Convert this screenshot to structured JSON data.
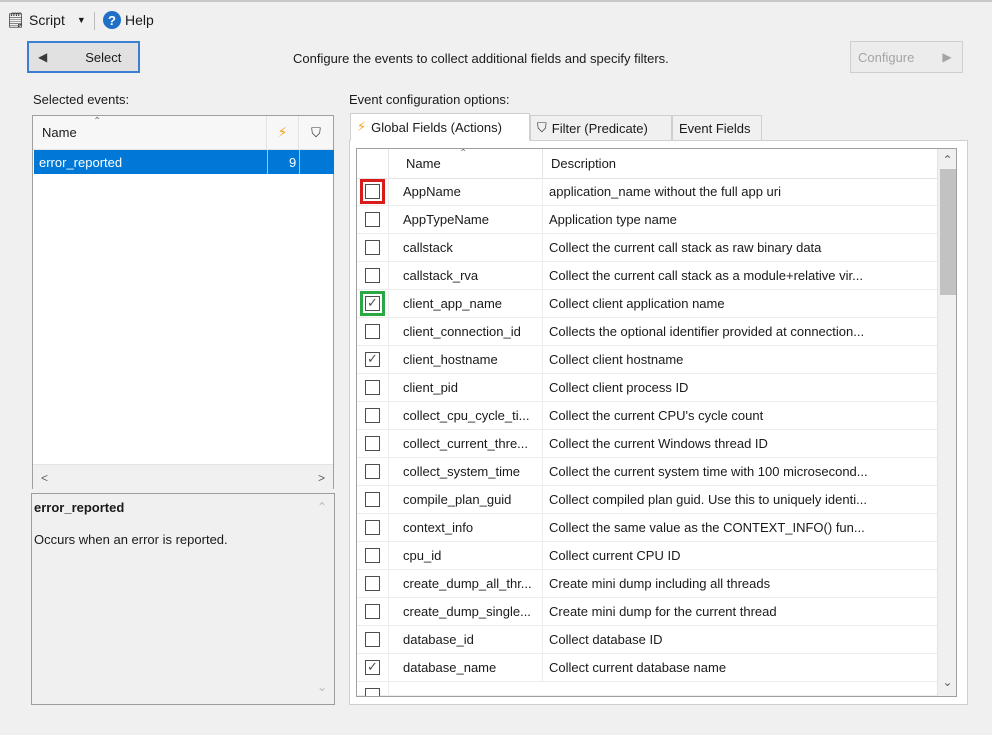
{
  "toolbar": {
    "script_label": "Script",
    "help_label": "Help"
  },
  "select_button_label": "Select",
  "configure_button_label": "Configure",
  "instruction": "Configure the events to collect additional fields and specify filters.",
  "selected_events": {
    "label": "Selected events:",
    "header_name": "Name",
    "rows": [
      {
        "name": "error_reported",
        "count": "9"
      }
    ]
  },
  "description": {
    "title": "error_reported",
    "text": "Occurs when an error is reported."
  },
  "config": {
    "label": "Event configuration options:",
    "tabs": [
      {
        "label": "Global Fields (Actions)",
        "active": true
      },
      {
        "label": "Filter (Predicate)",
        "active": false
      },
      {
        "label": "Event Fields",
        "active": false
      }
    ],
    "columns": {
      "name": "Name",
      "description": "Description"
    },
    "rows": [
      {
        "name": "AppName",
        "description": "application_name without the full app uri",
        "checked": false,
        "highlight": "red"
      },
      {
        "name": "AppTypeName",
        "description": "Application type name",
        "checked": false
      },
      {
        "name": "callstack",
        "description": "Collect the current call stack as raw binary data",
        "checked": false
      },
      {
        "name": "callstack_rva",
        "description": "Collect the current call stack as a module+relative vir...",
        "checked": false
      },
      {
        "name": "client_app_name",
        "description": "Collect client application name",
        "checked": true,
        "highlight": "green"
      },
      {
        "name": "client_connection_id",
        "description": "Collects the optional identifier provided at connection...",
        "checked": false
      },
      {
        "name": "client_hostname",
        "description": "Collect client hostname",
        "checked": true
      },
      {
        "name": "client_pid",
        "description": "Collect client process ID",
        "checked": false
      },
      {
        "name": "collect_cpu_cycle_ti...",
        "description": "Collect the current CPU's cycle count",
        "checked": false
      },
      {
        "name": "collect_current_thre...",
        "description": "Collect the current Windows thread ID",
        "checked": false
      },
      {
        "name": "collect_system_time",
        "description": "Collect the current system time with 100 microsecond...",
        "checked": false
      },
      {
        "name": "compile_plan_guid",
        "description": "Collect compiled plan guid. Use this to uniquely identi...",
        "checked": false
      },
      {
        "name": "context_info",
        "description": "Collect the same value as the CONTEXT_INFO() fun...",
        "checked": false
      },
      {
        "name": "cpu_id",
        "description": "Collect current CPU ID",
        "checked": false
      },
      {
        "name": "create_dump_all_thr...",
        "description": "Create mini dump including all threads",
        "checked": false
      },
      {
        "name": "create_dump_single...",
        "description": "Create mini dump for the current thread",
        "checked": false
      },
      {
        "name": "database_id",
        "description": "Collect database ID",
        "checked": false
      },
      {
        "name": "database_name",
        "description": "Collect current database name",
        "checked": true
      }
    ]
  },
  "colors": {
    "selection": "#0078d7",
    "highlight_red": "#d81b1b",
    "highlight_green": "#2aa844",
    "action_icon": "#f7a21b"
  }
}
